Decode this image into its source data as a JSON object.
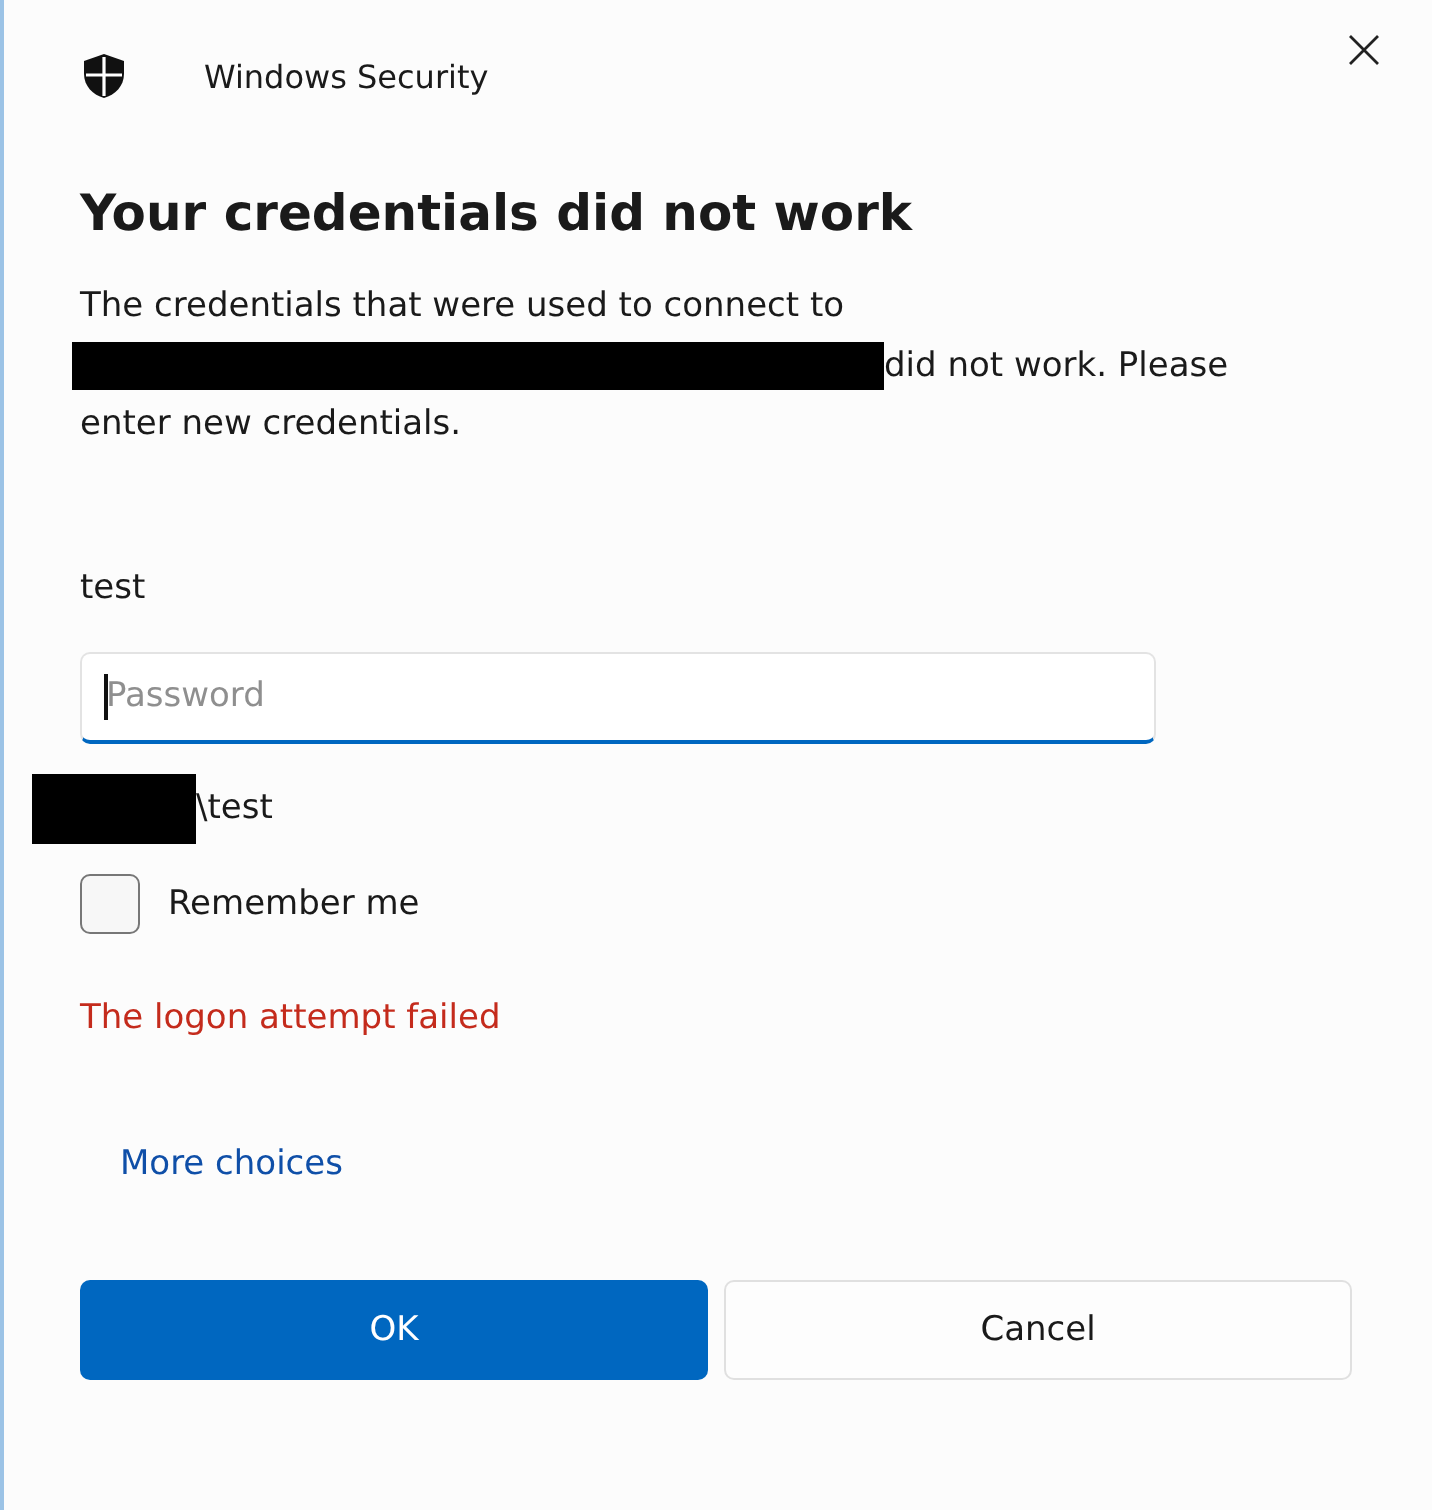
{
  "window": {
    "title": "Windows Security"
  },
  "heading": "Your credentials did not work",
  "message": [
    {
      "text": "The credentials that were used to connect to",
      "redacted_before": false
    },
    {
      "text": "did not work. Please",
      "redacted_before": true
    },
    {
      "text": "enter new credentials.",
      "redacted_before": false
    }
  ],
  "account": "test",
  "password": {
    "placeholder": "Password",
    "focused": true
  },
  "domain_user": {
    "text": "\\test",
    "redacted_before": true
  },
  "remember_me": {
    "label": "Remember me",
    "checked": false
  },
  "error": "The logon attempt failed",
  "link": "More choices",
  "buttons": [
    {
      "label": "OK",
      "kind": "primary"
    },
    {
      "label": "Cancel",
      "kind": "secondary"
    }
  ]
}
